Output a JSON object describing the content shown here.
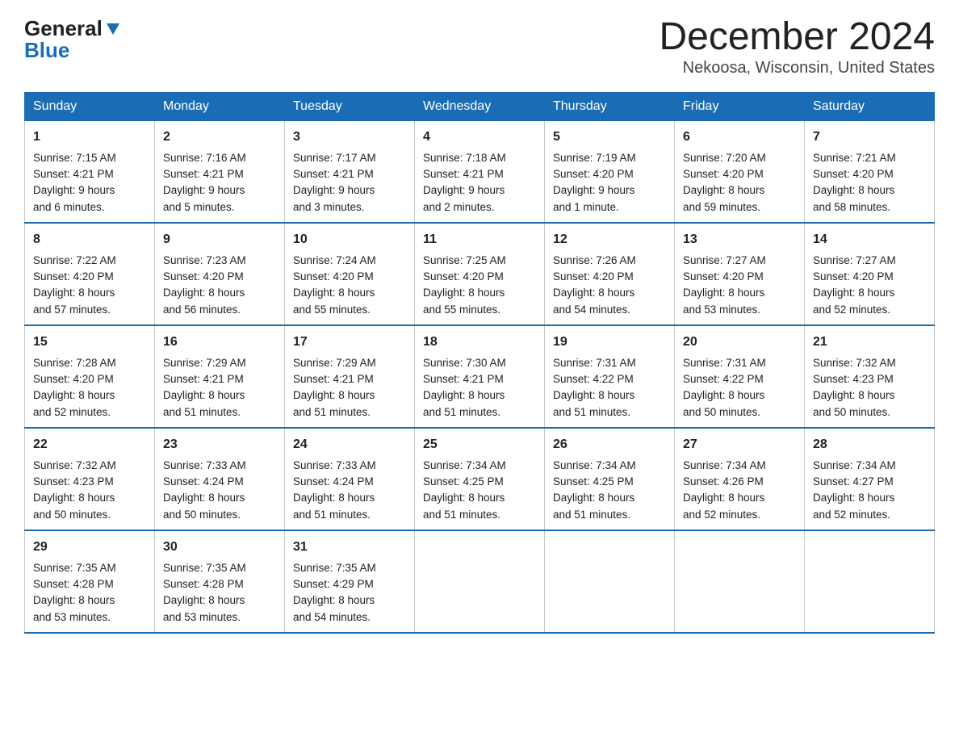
{
  "header": {
    "logo_line1": "General",
    "logo_line2": "Blue",
    "title": "December 2024",
    "subtitle": "Nekoosa, Wisconsin, United States"
  },
  "days_of_week": [
    "Sunday",
    "Monday",
    "Tuesday",
    "Wednesday",
    "Thursday",
    "Friday",
    "Saturday"
  ],
  "weeks": [
    [
      {
        "day": "1",
        "sunrise": "Sunrise: 7:15 AM",
        "sunset": "Sunset: 4:21 PM",
        "daylight": "Daylight: 9 hours",
        "daylight2": "and 6 minutes."
      },
      {
        "day": "2",
        "sunrise": "Sunrise: 7:16 AM",
        "sunset": "Sunset: 4:21 PM",
        "daylight": "Daylight: 9 hours",
        "daylight2": "and 5 minutes."
      },
      {
        "day": "3",
        "sunrise": "Sunrise: 7:17 AM",
        "sunset": "Sunset: 4:21 PM",
        "daylight": "Daylight: 9 hours",
        "daylight2": "and 3 minutes."
      },
      {
        "day": "4",
        "sunrise": "Sunrise: 7:18 AM",
        "sunset": "Sunset: 4:21 PM",
        "daylight": "Daylight: 9 hours",
        "daylight2": "and 2 minutes."
      },
      {
        "day": "5",
        "sunrise": "Sunrise: 7:19 AM",
        "sunset": "Sunset: 4:20 PM",
        "daylight": "Daylight: 9 hours",
        "daylight2": "and 1 minute."
      },
      {
        "day": "6",
        "sunrise": "Sunrise: 7:20 AM",
        "sunset": "Sunset: 4:20 PM",
        "daylight": "Daylight: 8 hours",
        "daylight2": "and 59 minutes."
      },
      {
        "day": "7",
        "sunrise": "Sunrise: 7:21 AM",
        "sunset": "Sunset: 4:20 PM",
        "daylight": "Daylight: 8 hours",
        "daylight2": "and 58 minutes."
      }
    ],
    [
      {
        "day": "8",
        "sunrise": "Sunrise: 7:22 AM",
        "sunset": "Sunset: 4:20 PM",
        "daylight": "Daylight: 8 hours",
        "daylight2": "and 57 minutes."
      },
      {
        "day": "9",
        "sunrise": "Sunrise: 7:23 AM",
        "sunset": "Sunset: 4:20 PM",
        "daylight": "Daylight: 8 hours",
        "daylight2": "and 56 minutes."
      },
      {
        "day": "10",
        "sunrise": "Sunrise: 7:24 AM",
        "sunset": "Sunset: 4:20 PM",
        "daylight": "Daylight: 8 hours",
        "daylight2": "and 55 minutes."
      },
      {
        "day": "11",
        "sunrise": "Sunrise: 7:25 AM",
        "sunset": "Sunset: 4:20 PM",
        "daylight": "Daylight: 8 hours",
        "daylight2": "and 55 minutes."
      },
      {
        "day": "12",
        "sunrise": "Sunrise: 7:26 AM",
        "sunset": "Sunset: 4:20 PM",
        "daylight": "Daylight: 8 hours",
        "daylight2": "and 54 minutes."
      },
      {
        "day": "13",
        "sunrise": "Sunrise: 7:27 AM",
        "sunset": "Sunset: 4:20 PM",
        "daylight": "Daylight: 8 hours",
        "daylight2": "and 53 minutes."
      },
      {
        "day": "14",
        "sunrise": "Sunrise: 7:27 AM",
        "sunset": "Sunset: 4:20 PM",
        "daylight": "Daylight: 8 hours",
        "daylight2": "and 52 minutes."
      }
    ],
    [
      {
        "day": "15",
        "sunrise": "Sunrise: 7:28 AM",
        "sunset": "Sunset: 4:20 PM",
        "daylight": "Daylight: 8 hours",
        "daylight2": "and 52 minutes."
      },
      {
        "day": "16",
        "sunrise": "Sunrise: 7:29 AM",
        "sunset": "Sunset: 4:21 PM",
        "daylight": "Daylight: 8 hours",
        "daylight2": "and 51 minutes."
      },
      {
        "day": "17",
        "sunrise": "Sunrise: 7:29 AM",
        "sunset": "Sunset: 4:21 PM",
        "daylight": "Daylight: 8 hours",
        "daylight2": "and 51 minutes."
      },
      {
        "day": "18",
        "sunrise": "Sunrise: 7:30 AM",
        "sunset": "Sunset: 4:21 PM",
        "daylight": "Daylight: 8 hours",
        "daylight2": "and 51 minutes."
      },
      {
        "day": "19",
        "sunrise": "Sunrise: 7:31 AM",
        "sunset": "Sunset: 4:22 PM",
        "daylight": "Daylight: 8 hours",
        "daylight2": "and 51 minutes."
      },
      {
        "day": "20",
        "sunrise": "Sunrise: 7:31 AM",
        "sunset": "Sunset: 4:22 PM",
        "daylight": "Daylight: 8 hours",
        "daylight2": "and 50 minutes."
      },
      {
        "day": "21",
        "sunrise": "Sunrise: 7:32 AM",
        "sunset": "Sunset: 4:23 PM",
        "daylight": "Daylight: 8 hours",
        "daylight2": "and 50 minutes."
      }
    ],
    [
      {
        "day": "22",
        "sunrise": "Sunrise: 7:32 AM",
        "sunset": "Sunset: 4:23 PM",
        "daylight": "Daylight: 8 hours",
        "daylight2": "and 50 minutes."
      },
      {
        "day": "23",
        "sunrise": "Sunrise: 7:33 AM",
        "sunset": "Sunset: 4:24 PM",
        "daylight": "Daylight: 8 hours",
        "daylight2": "and 50 minutes."
      },
      {
        "day": "24",
        "sunrise": "Sunrise: 7:33 AM",
        "sunset": "Sunset: 4:24 PM",
        "daylight": "Daylight: 8 hours",
        "daylight2": "and 51 minutes."
      },
      {
        "day": "25",
        "sunrise": "Sunrise: 7:34 AM",
        "sunset": "Sunset: 4:25 PM",
        "daylight": "Daylight: 8 hours",
        "daylight2": "and 51 minutes."
      },
      {
        "day": "26",
        "sunrise": "Sunrise: 7:34 AM",
        "sunset": "Sunset: 4:25 PM",
        "daylight": "Daylight: 8 hours",
        "daylight2": "and 51 minutes."
      },
      {
        "day": "27",
        "sunrise": "Sunrise: 7:34 AM",
        "sunset": "Sunset: 4:26 PM",
        "daylight": "Daylight: 8 hours",
        "daylight2": "and 52 minutes."
      },
      {
        "day": "28",
        "sunrise": "Sunrise: 7:34 AM",
        "sunset": "Sunset: 4:27 PM",
        "daylight": "Daylight: 8 hours",
        "daylight2": "and 52 minutes."
      }
    ],
    [
      {
        "day": "29",
        "sunrise": "Sunrise: 7:35 AM",
        "sunset": "Sunset: 4:28 PM",
        "daylight": "Daylight: 8 hours",
        "daylight2": "and 53 minutes."
      },
      {
        "day": "30",
        "sunrise": "Sunrise: 7:35 AM",
        "sunset": "Sunset: 4:28 PM",
        "daylight": "Daylight: 8 hours",
        "daylight2": "and 53 minutes."
      },
      {
        "day": "31",
        "sunrise": "Sunrise: 7:35 AM",
        "sunset": "Sunset: 4:29 PM",
        "daylight": "Daylight: 8 hours",
        "daylight2": "and 54 minutes."
      },
      {
        "day": "",
        "sunrise": "",
        "sunset": "",
        "daylight": "",
        "daylight2": ""
      },
      {
        "day": "",
        "sunrise": "",
        "sunset": "",
        "daylight": "",
        "daylight2": ""
      },
      {
        "day": "",
        "sunrise": "",
        "sunset": "",
        "daylight": "",
        "daylight2": ""
      },
      {
        "day": "",
        "sunrise": "",
        "sunset": "",
        "daylight": "",
        "daylight2": ""
      }
    ]
  ]
}
